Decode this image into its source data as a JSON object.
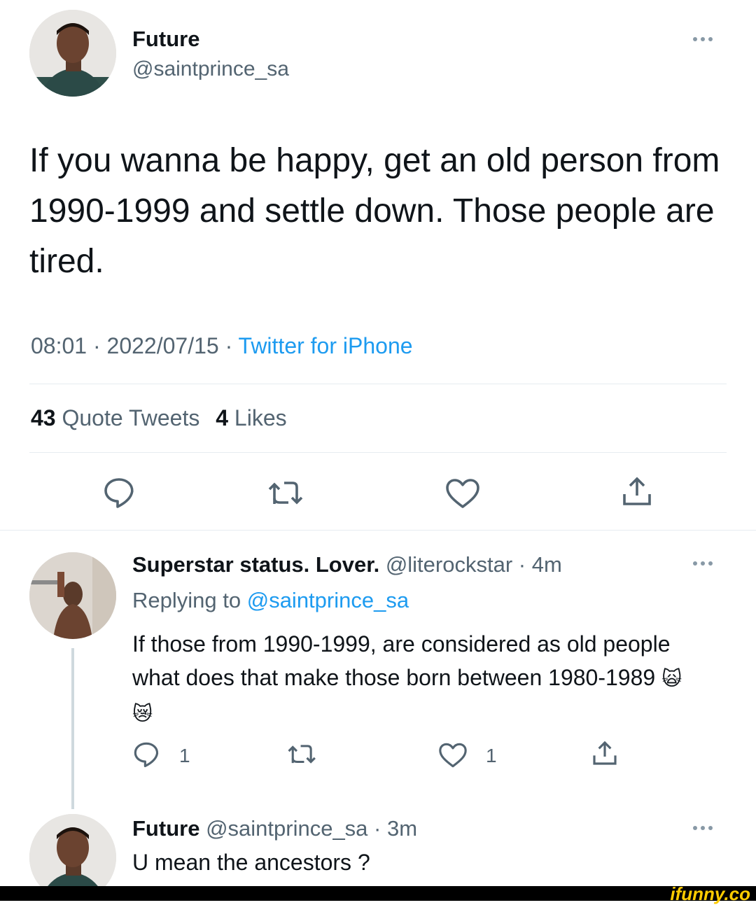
{
  "main_tweet": {
    "display_name": "Future",
    "handle": "@saintprince_sa",
    "text": "If you wanna be happy, get an old person from 1990-1999 and settle down. Those people are tired.",
    "time": "08:01",
    "date": "2022/07/15",
    "source": "Twitter for iPhone",
    "quote_tweets_count": "43",
    "quote_tweets_label": "Quote Tweets",
    "likes_count": "4",
    "likes_label": "Likes"
  },
  "reply_1": {
    "display_name": "Superstar status. Lover.",
    "handle": "@literockstar",
    "time_ago": "4m",
    "replying_label": "Replying to",
    "replying_handle": "@saintprince_sa",
    "text": "If those from 1990-1999, are considered as old people what does that make those born between 1980-1989",
    "emojis": "🙀😿",
    "reply_count": "1",
    "like_count": "1"
  },
  "reply_2": {
    "display_name": "Future",
    "handle": "@saintprince_sa",
    "time_ago": "3m",
    "text": "U mean the ancestors ?"
  },
  "watermark": "ifunny.co",
  "icons": [
    "reply-icon",
    "retweet-icon",
    "like-icon",
    "share-icon",
    "more-options-icon"
  ],
  "colors": {
    "accent": "#1d9bf0",
    "secondary_text": "#536471",
    "divider": "#e6ecf0"
  }
}
